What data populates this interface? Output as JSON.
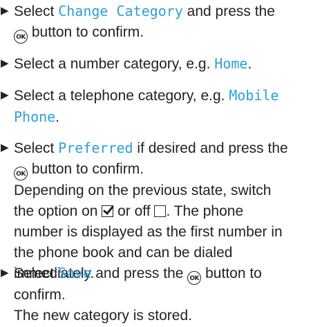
{
  "steps": [
    {
      "pre": "Select ",
      "highlight": "Change Category",
      "mid": " and press the",
      "ok_label": "OK",
      "post": " button to confirm."
    },
    {
      "pre": "Select a number category, e.g. ",
      "highlight": "Home",
      "post": "."
    },
    {
      "pre": "Select a telephone category, e.g. ",
      "highlight_line1": "Mobile",
      "highlight_line2": "Phone",
      "post": "."
    },
    {
      "pre": "Select ",
      "highlight": "Preferred",
      "mid": " if desired and press the",
      "ok_label": "OK",
      "post": " button to confirm.",
      "note_1": "Depending on the previous state, switch",
      "note_2a": "the option on ",
      "note_2b": " or off ",
      "note_2c": ". The phone",
      "note_3": "number is displayed as the first number in",
      "note_4": "the phone book and can be dialed",
      "note_5": "immediately."
    },
    {
      "pre": "Select ",
      "highlight": "Save",
      "mid": " and press the ",
      "ok_label": "OK",
      "post": " button to",
      "post_2": "confirm.",
      "note": "The new category is stored."
    }
  ],
  "icons": {
    "bullet": "triangle-right",
    "ok": "ok-button",
    "checkbox_checked": "checkbox-checked",
    "checkbox_empty": "checkbox-empty"
  },
  "colors": {
    "text": "#222222",
    "highlight": "#2aa1d8"
  }
}
